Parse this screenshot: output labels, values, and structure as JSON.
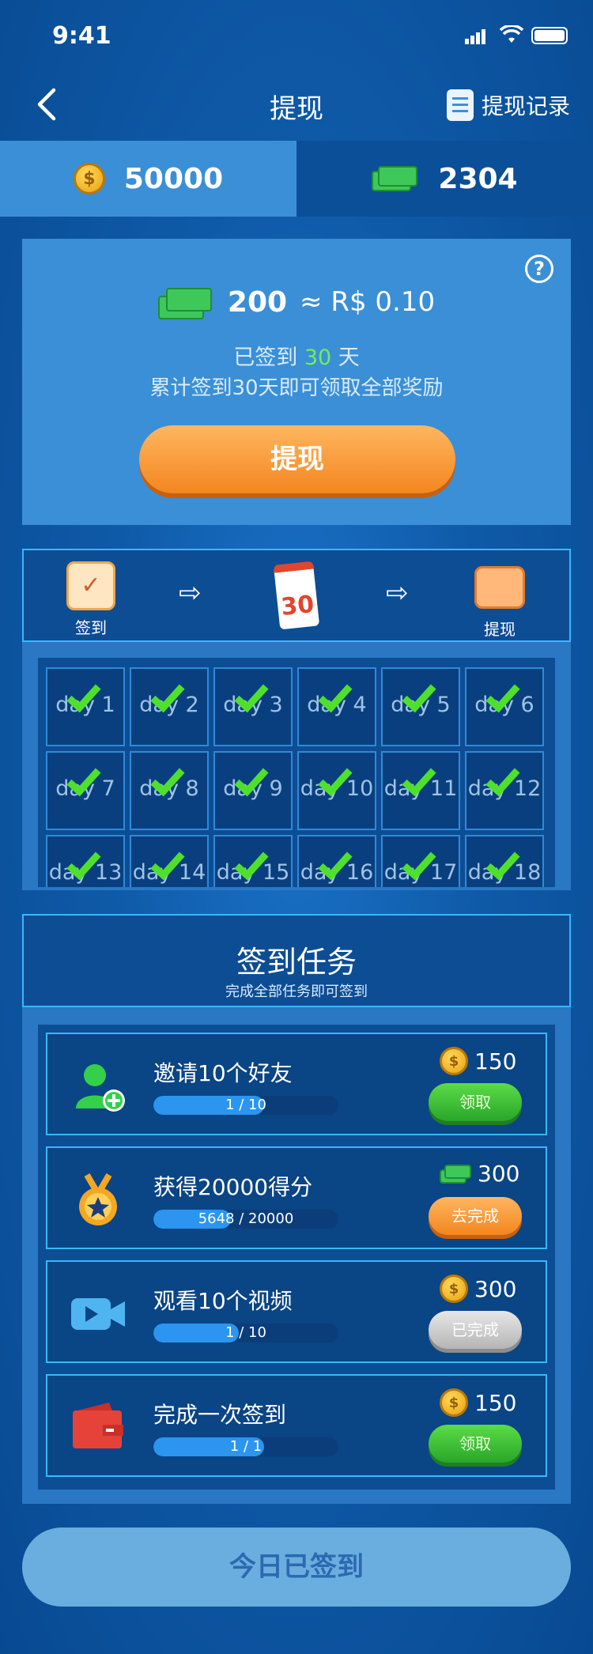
{
  "status_bar": {
    "time": "9:41"
  },
  "nav": {
    "title": "提现",
    "record_label": "提现记录"
  },
  "balances": {
    "coins": "50000",
    "cash": "2304"
  },
  "withdraw_card": {
    "amount": "200",
    "approx": "≈ R$ 0.10",
    "signed_prefix": "已签到",
    "signed_days": "30",
    "signed_suffix": "天",
    "note": "累计签到30天即可领取全部奖励",
    "button": "提现",
    "help": "?"
  },
  "progress_strip": {
    "step1": "签到",
    "step2_number": "30",
    "step3": "提现"
  },
  "days": [
    {
      "label": "day 1",
      "checked": true
    },
    {
      "label": "day 2",
      "checked": true
    },
    {
      "label": "day 3",
      "checked": true
    },
    {
      "label": "day 4",
      "checked": true
    },
    {
      "label": "day 5",
      "checked": true
    },
    {
      "label": "day 6",
      "checked": true
    },
    {
      "label": "day 7",
      "checked": true
    },
    {
      "label": "day 8",
      "checked": true
    },
    {
      "label": "day 9",
      "checked": true
    },
    {
      "label": "day 10",
      "checked": true
    },
    {
      "label": "day 11",
      "checked": true
    },
    {
      "label": "day 12",
      "checked": true
    },
    {
      "label": "day 13",
      "checked": true
    },
    {
      "label": "day 14",
      "checked": true
    },
    {
      "label": "day 15",
      "checked": true
    },
    {
      "label": "day 16",
      "checked": true
    },
    {
      "label": "day 17",
      "checked": true
    },
    {
      "label": "day 18",
      "checked": true
    }
  ],
  "tasks_header": {
    "title": "签到任务",
    "subtitle": "完成全部任务即可签到"
  },
  "tasks": [
    {
      "name": "邀请10个好友",
      "progress_current": "1",
      "progress_total": "10",
      "fill": 0.6,
      "reward": "150",
      "reward_icon": "coin-icon",
      "button": "领取",
      "button_style": "green",
      "icon": "add-friend-icon"
    },
    {
      "name": "获得20000得分",
      "progress_current": "5648",
      "progress_total": "20000",
      "fill": 0.42,
      "reward": "300",
      "reward_icon": "cash-icon",
      "button": "去完成",
      "button_style": "orange",
      "icon": "medal-icon"
    },
    {
      "name": "观看10个视频",
      "progress_current": "1",
      "progress_total": "10",
      "fill": 0.46,
      "reward": "300",
      "reward_icon": "coin-icon",
      "button": "已完成",
      "button_style": "gray",
      "icon": "video-icon"
    },
    {
      "name": "完成一次签到",
      "progress_current": "1",
      "progress_total": "1",
      "fill": 0.6,
      "reward": "150",
      "reward_icon": "coin-icon",
      "button": "领取",
      "button_style": "green",
      "icon": "wallet-icon"
    }
  ],
  "footer": {
    "button": "今日已签到"
  },
  "colors": {
    "accent_orange": "#f3861f",
    "accent_green": "#2aa52a",
    "highlight_green": "#6cf05a"
  }
}
